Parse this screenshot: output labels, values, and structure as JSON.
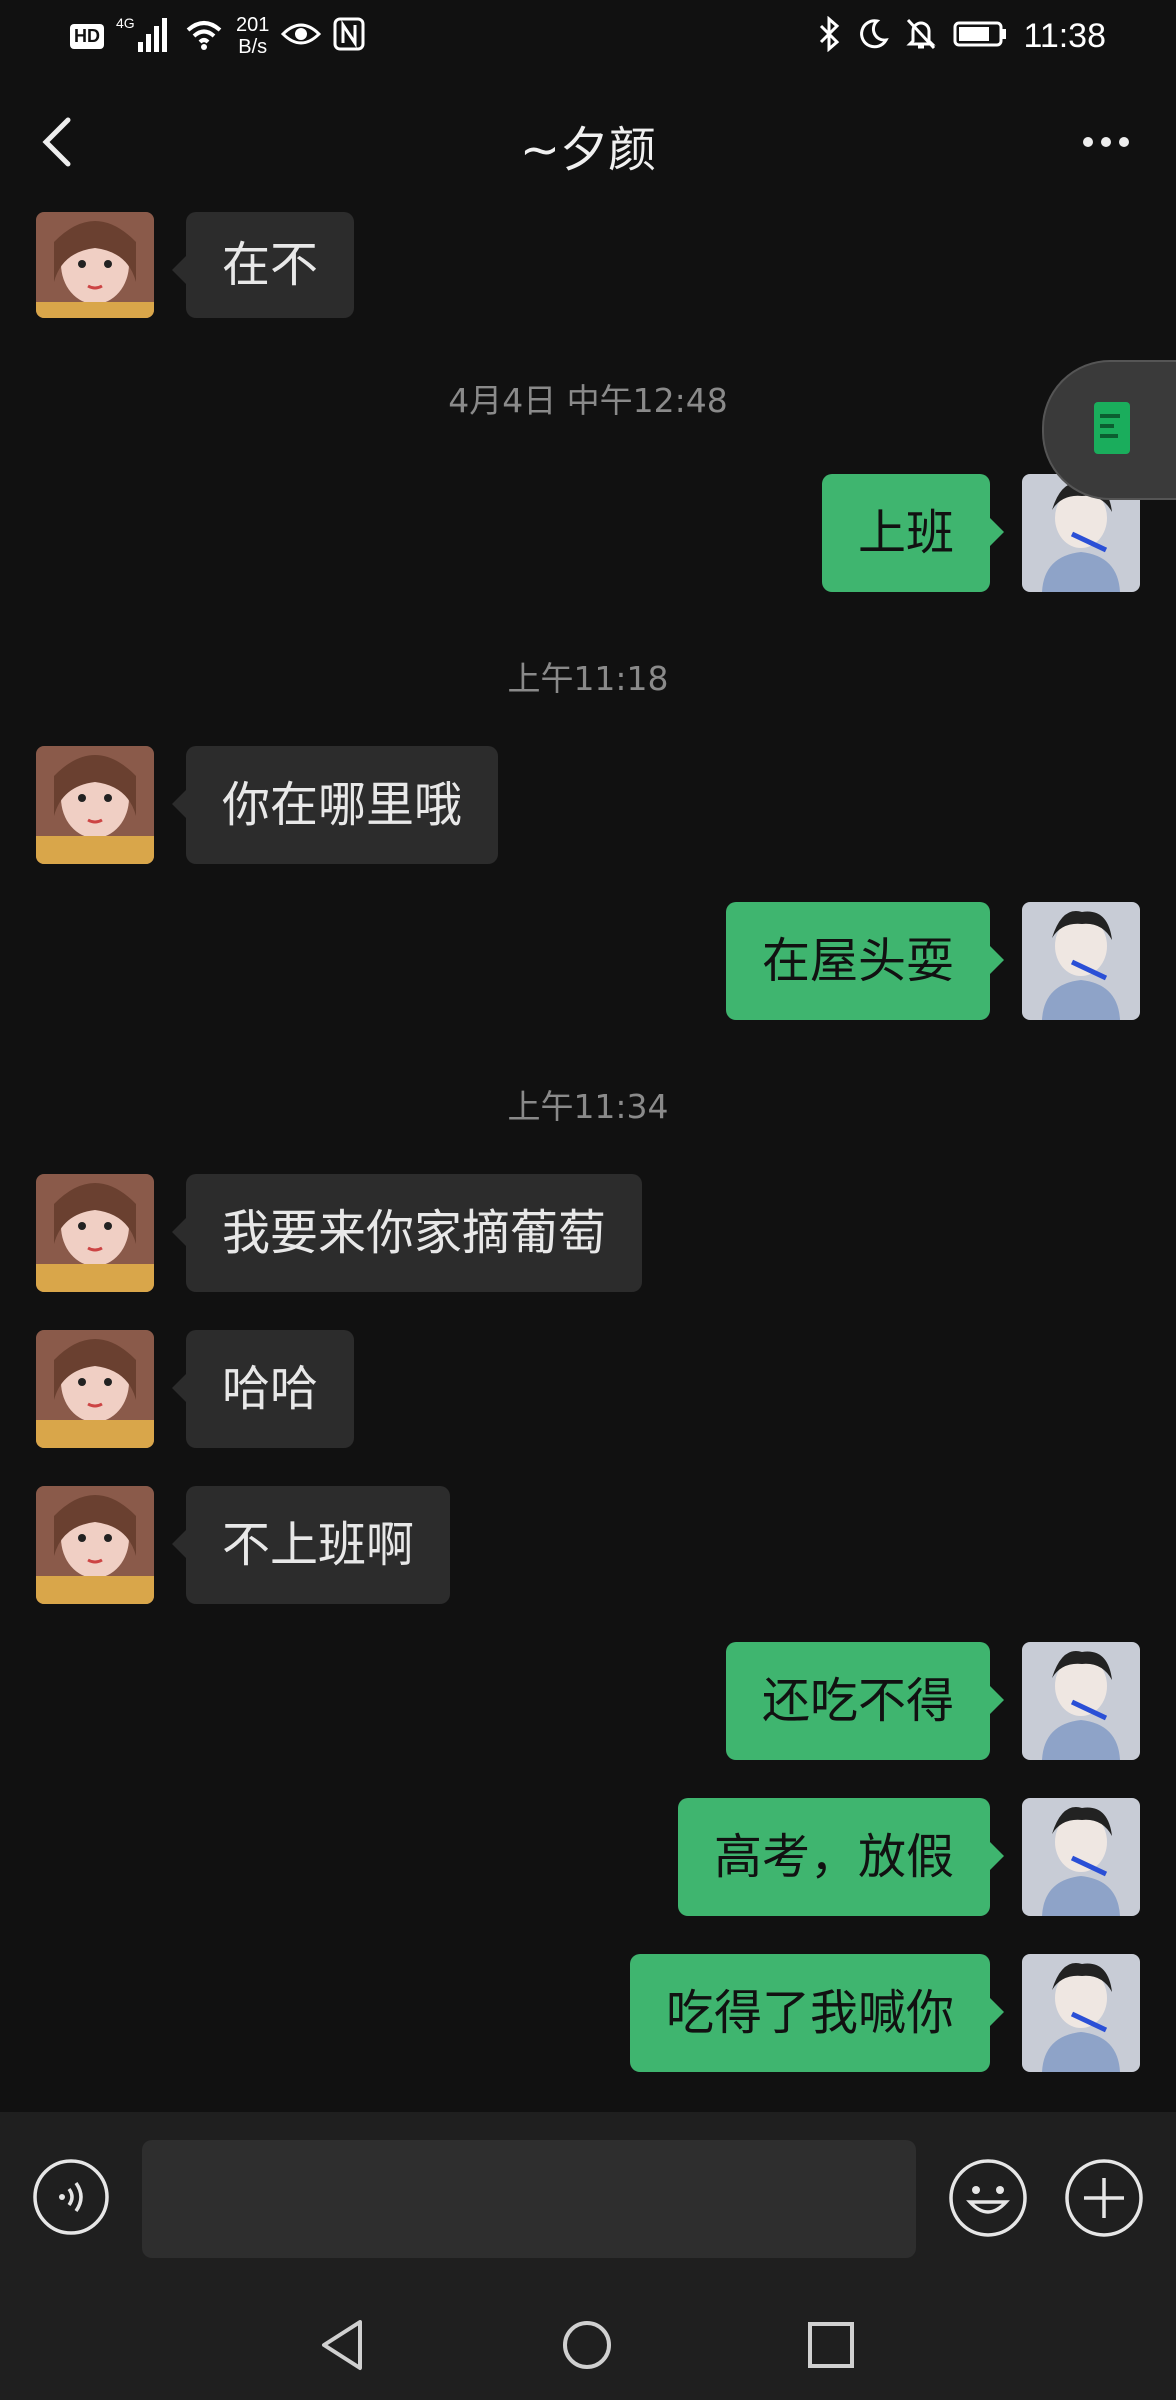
{
  "status_bar": {
    "hd": "HD",
    "network": "4G",
    "speed_top": "201",
    "speed_bottom": "B/s",
    "time": "11:38",
    "icons": [
      "hd-icon",
      "signal-4g-icon",
      "wifi-icon",
      "eye-icon",
      "nfc-icon",
      "bluetooth-icon",
      "moon-icon",
      "bell-off-icon",
      "battery-icon"
    ]
  },
  "header": {
    "title": "~夕颜",
    "back_icon": "chevron-left-icon",
    "more_icon": "more-dots-icon"
  },
  "messages": [
    {
      "type": "in",
      "text": "在不"
    },
    {
      "type": "timestamp",
      "text": "4月4日 中午12:48"
    },
    {
      "type": "out",
      "text": "上班"
    },
    {
      "type": "timestamp",
      "text": "上午11:18"
    },
    {
      "type": "in",
      "text": "你在哪里哦"
    },
    {
      "type": "out",
      "text": "在屋头耍"
    },
    {
      "type": "timestamp",
      "text": "上午11:34"
    },
    {
      "type": "in",
      "text": "我要来你家摘葡萄"
    },
    {
      "type": "in",
      "text": "哈哈"
    },
    {
      "type": "in",
      "text": "不上班啊"
    },
    {
      "type": "out",
      "text": "还吃不得"
    },
    {
      "type": "out",
      "text": "高考，放假"
    },
    {
      "type": "out",
      "text": "吃得了我喊你"
    }
  ],
  "input_bar": {
    "placeholder": "",
    "icons": [
      "voice-icon",
      "emoji-icon",
      "plus-icon"
    ]
  },
  "colors": {
    "background": "#111111",
    "bubble_in": "#2c2c2c",
    "bubble_out": "#3fb56f",
    "timestamp": "#8a8a8a"
  }
}
